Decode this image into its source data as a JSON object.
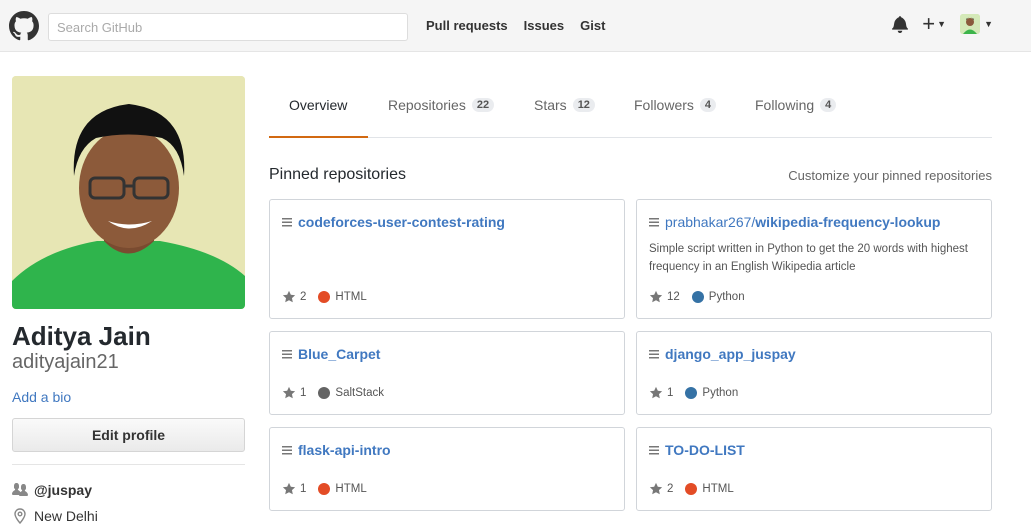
{
  "header": {
    "search_placeholder": "Search GitHub",
    "nav": [
      "Pull requests",
      "Issues",
      "Gist"
    ],
    "plus": "+"
  },
  "profile": {
    "full_name": "Aditya Jain",
    "username": "adityajain21",
    "add_bio": "Add a bio",
    "edit_profile": "Edit profile",
    "organization": "@juspay",
    "location": "New Delhi"
  },
  "tabs": [
    {
      "label": "Overview",
      "count": ""
    },
    {
      "label": "Repositories",
      "count": "22"
    },
    {
      "label": "Stars",
      "count": "12"
    },
    {
      "label": "Followers",
      "count": "4"
    },
    {
      "label": "Following",
      "count": "4"
    }
  ],
  "pinned": {
    "title": "Pinned repositories",
    "customize": "Customize your pinned repositories",
    "repos": [
      {
        "owner": "",
        "name": "codeforces-user-contest-rating",
        "description": "",
        "stars": "2",
        "language": "HTML",
        "lang_color": "#e34c26"
      },
      {
        "owner": "prabhakar267/",
        "name": "wikipedia-frequency-lookup",
        "description": "Simple script written in Python to get the 20 words with highest frequency in an English Wikipedia article",
        "stars": "12",
        "language": "Python",
        "lang_color": "#3572a5"
      },
      {
        "owner": "",
        "name": "Blue_Carpet",
        "description": "",
        "stars": "1",
        "language": "SaltStack",
        "lang_color": "#646464"
      },
      {
        "owner": "",
        "name": "django_app_juspay",
        "description": "",
        "stars": "1",
        "language": "Python",
        "lang_color": "#3572a5"
      },
      {
        "owner": "",
        "name": "flask-api-intro",
        "description": "",
        "stars": "1",
        "language": "HTML",
        "lang_color": "#e34c26"
      },
      {
        "owner": "",
        "name": "TO-DO-LIST",
        "description": "",
        "stars": "2",
        "language": "HTML",
        "lang_color": "#e34c26"
      }
    ]
  },
  "colors": {
    "accent": "#d26911",
    "link": "#4078c0"
  }
}
